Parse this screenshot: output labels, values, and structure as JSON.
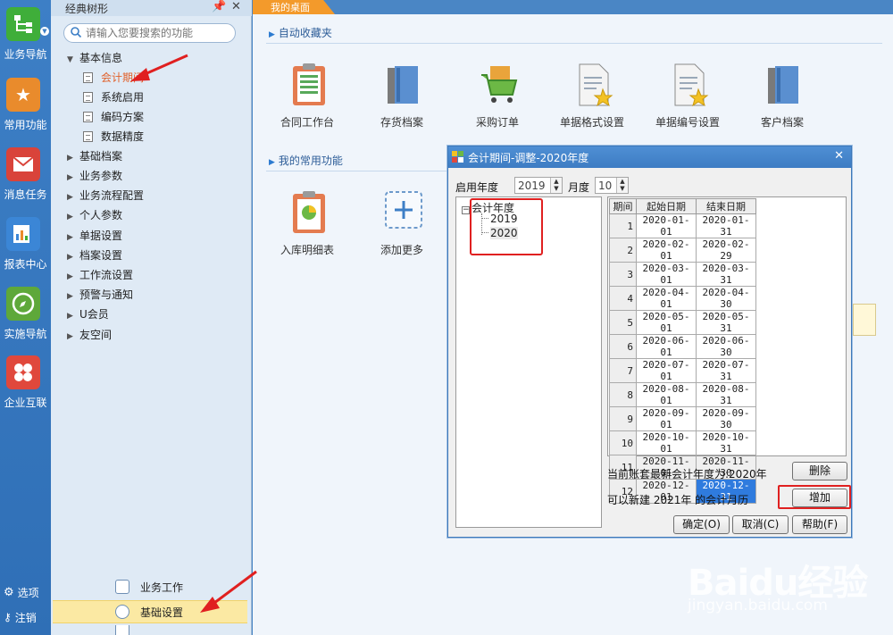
{
  "rail": {
    "items": [
      {
        "label": "业务导航",
        "color": "#3fae3a",
        "icon": "org-tree-icon"
      },
      {
        "label": "常用功能",
        "color": "#e98b2c",
        "icon": "star-icon"
      },
      {
        "label": "消息任务",
        "color": "#d9433a",
        "icon": "mail-icon"
      },
      {
        "label": "报表中心",
        "color": "#3b86d6",
        "icon": "chart-report-icon"
      },
      {
        "label": "实施导航",
        "color": "#5ea83a",
        "icon": "compass-icon"
      },
      {
        "label": "企业互联",
        "color": "#e0483c",
        "icon": "puzzle-icon"
      }
    ],
    "options_label": "选项",
    "logout_label": "注销"
  },
  "tree": {
    "title": "经典树形",
    "search_placeholder": "请输入您要搜索的功能",
    "root_label": "基本信息",
    "root_children": [
      "会计期间",
      "系统启用",
      "编码方案",
      "数据精度"
    ],
    "groups": [
      "基础档案",
      "业务参数",
      "业务流程配置",
      "个人参数",
      "单据设置",
      "档案设置",
      "工作流设置",
      "预警与通知",
      "U会员",
      "友空间"
    ],
    "nav_work": "业务工作",
    "nav_basic": "基础设置"
  },
  "main": {
    "tab_label": "我的桌面",
    "favorites_title": "自动收藏夹",
    "favorites": [
      "合同工作台",
      "存货档案",
      "采购订单",
      "单据格式设置",
      "单据编号设置",
      "客户档案"
    ],
    "common_title": "我的常用功能",
    "common": [
      "入库明细表",
      "添加更多"
    ]
  },
  "dialog": {
    "title": "会计期间-调整-2020年度",
    "start_year_label": "启用年度",
    "start_year_value": "2019",
    "month_label": "月度",
    "month_value": "10",
    "tree_root": "会计年度",
    "years": [
      "2019",
      "2020"
    ],
    "columns": [
      "期间",
      "起始日期",
      "结束日期"
    ],
    "periods": [
      [
        "1",
        "2020-01-01",
        "2020-01-31"
      ],
      [
        "2",
        "2020-02-01",
        "2020-02-29"
      ],
      [
        "3",
        "2020-03-01",
        "2020-03-31"
      ],
      [
        "4",
        "2020-04-01",
        "2020-04-30"
      ],
      [
        "5",
        "2020-05-01",
        "2020-05-31"
      ],
      [
        "6",
        "2020-06-01",
        "2020-06-30"
      ],
      [
        "7",
        "2020-07-01",
        "2020-07-31"
      ],
      [
        "8",
        "2020-08-01",
        "2020-08-31"
      ],
      [
        "9",
        "2020-09-01",
        "2020-09-30"
      ],
      [
        "10",
        "2020-10-01",
        "2020-10-31"
      ],
      [
        "11",
        "2020-11-01",
        "2020-11-30"
      ],
      [
        "12",
        "2020-12-01",
        "2020-12-31"
      ]
    ],
    "latest_year_text": "当前账套最新会计年度为:2020年",
    "new_year_text": "可以新建 2021年 的会计月历",
    "delete_label": "删除",
    "add_label": "增加",
    "ok_label": "确定(O)",
    "cancel_label": "取消(C)",
    "help_label": "帮助(F)"
  },
  "watermark": {
    "brand": "Baidu经验",
    "url": "jingyan.baidu.com"
  },
  "colors": {
    "accent": "#3d7fc6",
    "tab": "#f39a2b",
    "highlight": "#e02020",
    "selection": "#2f7bde"
  }
}
